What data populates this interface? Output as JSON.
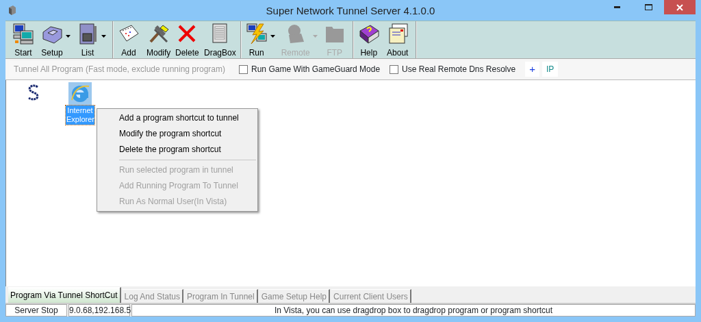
{
  "window": {
    "title": "Super Network Tunnel Server 4.1.0.0"
  },
  "toolbar": {
    "groups": [
      {
        "buttons": [
          {
            "label": "Start",
            "disabled": false,
            "dropdown": false
          },
          {
            "label": "Setup",
            "disabled": false,
            "dropdown": true
          },
          {
            "label": "List",
            "disabled": false,
            "dropdown": true
          }
        ]
      },
      {
        "buttons": [
          {
            "label": "Add",
            "disabled": false,
            "dropdown": false
          },
          {
            "label": "Modify",
            "disabled": false,
            "dropdown": false
          },
          {
            "label": "Delete",
            "disabled": false,
            "dropdown": false
          },
          {
            "label": "DragBox",
            "disabled": false,
            "dropdown": false
          }
        ]
      },
      {
        "buttons": [
          {
            "label": "Run",
            "disabled": false,
            "dropdown": true
          },
          {
            "label": "Remote",
            "disabled": true,
            "dropdown": true
          },
          {
            "label": "FTP",
            "disabled": true,
            "dropdown": false
          }
        ]
      },
      {
        "buttons": [
          {
            "label": "Help",
            "disabled": false,
            "dropdown": false
          },
          {
            "label": "About",
            "disabled": false,
            "dropdown": false
          }
        ]
      }
    ]
  },
  "options": [
    {
      "kind": "button",
      "label": "Tunnel All Program (Fast mode, exclude running program)",
      "disabled": true
    },
    {
      "kind": "checkbox",
      "label": "Run Game With GameGuard Mode",
      "checked": false
    },
    {
      "kind": "checkbox",
      "label": "Use Real Remote Dns Resolve",
      "checked": false
    },
    {
      "kind": "plus",
      "label": "+"
    },
    {
      "kind": "ip",
      "label": "IP"
    }
  ],
  "shortcuts": [
    {
      "selected": false
    },
    {
      "label": "Internet Explorer",
      "selected": true
    }
  ],
  "context_menu": [
    {
      "kind": "item",
      "label": "Add a program shortcut to tunnel",
      "disabled": false
    },
    {
      "kind": "item",
      "label": "Modify the program shortcut",
      "disabled": false
    },
    {
      "kind": "item",
      "label": "Delete the program shortcut",
      "disabled": false
    },
    {
      "kind": "separator"
    },
    {
      "kind": "item",
      "label": "Run selected program in tunnel",
      "disabled": true
    },
    {
      "kind": "item",
      "label": "Add Running Program To Tunnel",
      "disabled": true
    },
    {
      "kind": "item",
      "label": "Run As Normal User(In Vista)",
      "disabled": true
    }
  ],
  "tabs": [
    {
      "label": "Program Via Tunnel ShortCut",
      "selected": true
    },
    {
      "label": "Log And Status",
      "selected": false
    },
    {
      "label": "Program In Tunnel",
      "selected": false
    },
    {
      "label": "Game Setup Help",
      "selected": false
    },
    {
      "label": "Current Client Users",
      "selected": false
    }
  ],
  "status_bar": [
    {
      "text": "Server Stop"
    },
    {
      "text": "9.0.68,192.168.5"
    },
    {
      "text": "In Vista, you can use dragdrop box to dragdrop program or program shortcut"
    }
  ]
}
